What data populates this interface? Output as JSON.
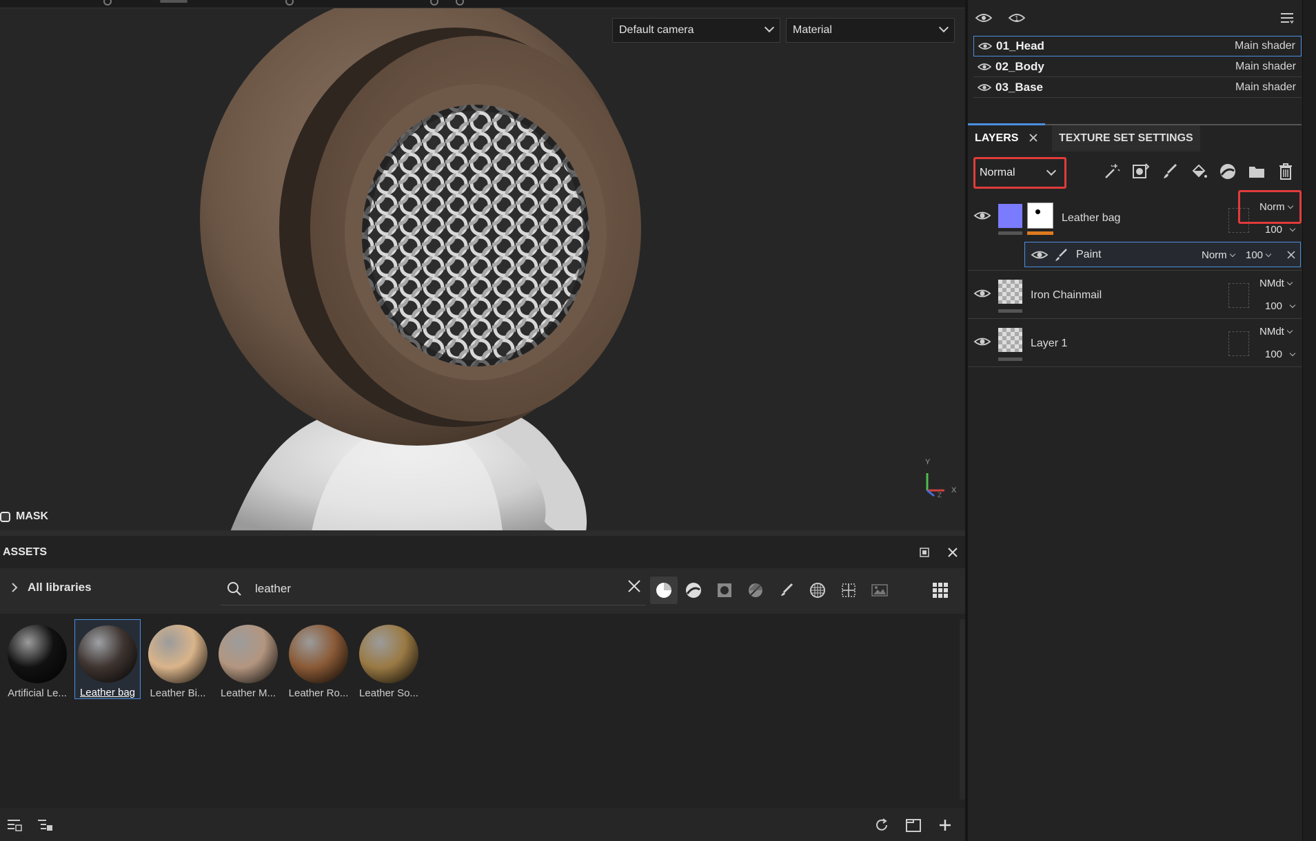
{
  "viewport": {
    "camera_select": "Default camera",
    "view_mode_select": "Material",
    "mask_label": "MASK",
    "axis": {
      "y": "Y",
      "x": "X",
      "z": "Z"
    }
  },
  "assets": {
    "title": "ASSETS",
    "library": "All libraries",
    "search_value": "leather",
    "items": [
      {
        "label": "Artificial Le...",
        "color": "#111111"
      },
      {
        "label": "Leather bag",
        "color": "#3e3430",
        "selected": true
      },
      {
        "label": "Leather Bi...",
        "color": "#d9b48a"
      },
      {
        "label": "Leather M...",
        "color": "#b39680"
      },
      {
        "label": "Leather Ro...",
        "color": "#8a5a36"
      },
      {
        "label": "Leather So...",
        "color": "#9a7a44"
      }
    ]
  },
  "texture_sets": [
    {
      "name": "01_Head",
      "shader": "Main shader",
      "selected": true
    },
    {
      "name": "02_Body",
      "shader": "Main shader"
    },
    {
      "name": "03_Base",
      "shader": "Main shader"
    }
  ],
  "tabs": {
    "layers": "LAYERS",
    "texture_set_settings": "TEXTURE SET SETTINGS"
  },
  "layers_panel": {
    "blend_mode": "Normal",
    "layers": [
      {
        "name": "Leather bag",
        "blend": "Norm",
        "opacity": "100"
      },
      {
        "name": "Iron Chainmail",
        "blend": "NMdt",
        "opacity": "100"
      },
      {
        "name": "Layer 1",
        "blend": "NMdt",
        "opacity": "100"
      }
    ],
    "effect": {
      "name": "Paint",
      "blend": "Norm",
      "opacity": "100"
    }
  },
  "colors": {
    "accent": "#4a90e2",
    "highlight": "#e23b3b",
    "layer_color": "#7b7bff",
    "orange_bar": "#e07a1f"
  }
}
